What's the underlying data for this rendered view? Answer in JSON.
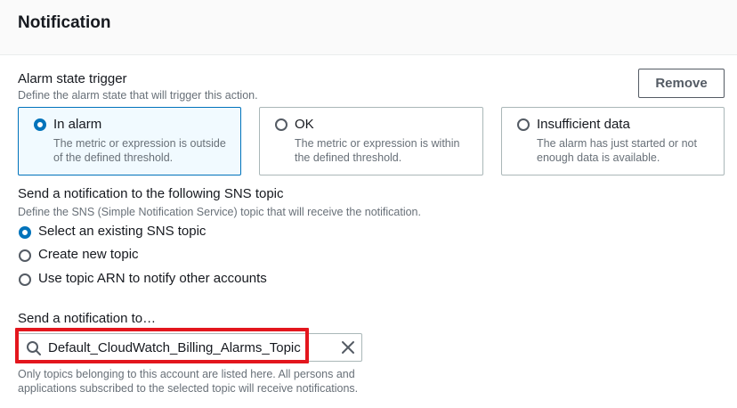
{
  "header": {
    "title": "Notification"
  },
  "alarm_trigger": {
    "label": "Alarm state trigger",
    "description": "Define the alarm state that will trigger this action.",
    "remove_label": "Remove",
    "tiles": [
      {
        "title": "In alarm",
        "desc1": "The metric or expression is outside",
        "desc2": "of the defined threshold.",
        "selected": true
      },
      {
        "title": "OK",
        "desc1": "The metric or expression is within",
        "desc2": "the defined threshold.",
        "selected": false
      },
      {
        "title": "Insufficient data",
        "desc1": "The alarm has just started or not",
        "desc2": "enough data is available.",
        "selected": false
      }
    ]
  },
  "sns": {
    "label": "Send a notification to the following SNS topic",
    "description": "Define the SNS (Simple Notification Service) topic that will receive the notification.",
    "options": [
      {
        "label": "Select an existing SNS topic",
        "selected": true
      },
      {
        "label": "Create new topic",
        "selected": false
      },
      {
        "label": "Use topic ARN to notify other accounts",
        "selected": false
      }
    ]
  },
  "send_to": {
    "label": "Send a notification to…",
    "value": "Default_CloudWatch_Billing_Alarms_Topic",
    "help1": "Only topics belonging to this account are listed here. All persons and",
    "help2": "applications subscribed to the selected topic will receive notifications."
  },
  "colors": {
    "accent": "#0073bb",
    "highlight": "#e3161d",
    "selected_bg": "#f1faff"
  },
  "icons": {
    "search": "search-icon",
    "clear": "close-icon"
  }
}
